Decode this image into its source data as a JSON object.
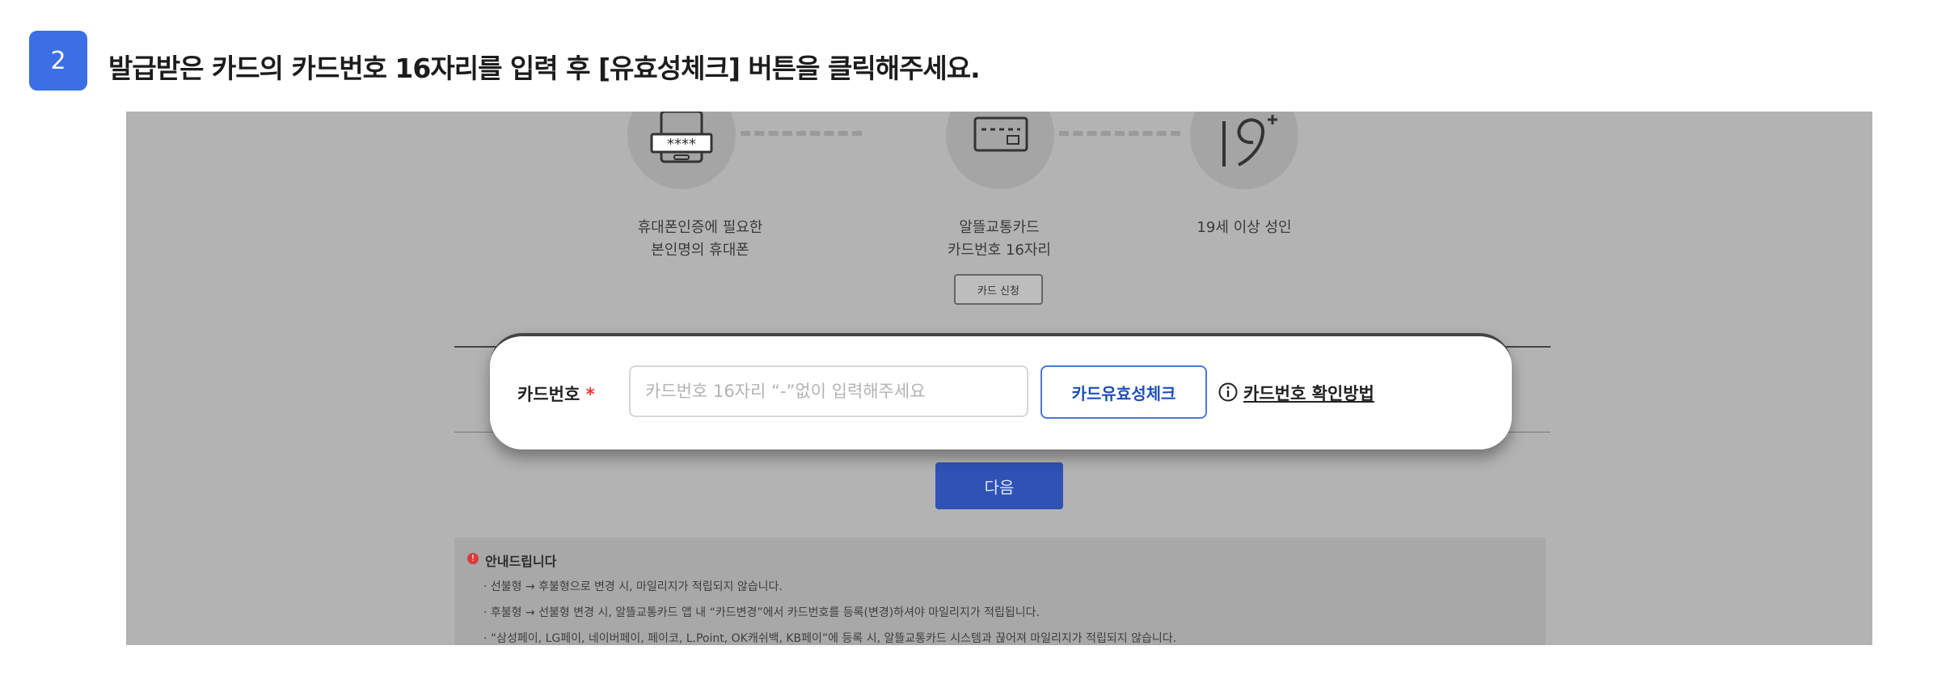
{
  "step": {
    "number": "2",
    "title": "발급받은 카드의 카드번호 16자리를 입력 후 [유효성체크] 버튼을 클릭해주세요."
  },
  "requirements": [
    {
      "icon": "phone-icon",
      "line1": "휴대폰인증에 필요한",
      "line2": "본인명의 휴대폰"
    },
    {
      "icon": "card-icon",
      "line1": "알뜰교통카드",
      "line2": "카드번호 16자리"
    },
    {
      "icon": "age-19-icon",
      "line1": "19세 이상 성인",
      "line2": ""
    }
  ],
  "apply_button": "카드 신청",
  "card_form": {
    "label": "카드번호",
    "required_mark": "*",
    "input_placeholder": "카드번호 16자리 “-”없이 입력해주세요",
    "input_value": "",
    "check_button": "카드유효성체크",
    "help_link": "카드번호 확인방법"
  },
  "next_button": "다음",
  "notice": {
    "title": "안내드립니다",
    "icon": "alert-icon",
    "lines": [
      "· 선불형 → 후불형으로 변경 시, 마일리지가 적립되지 않습니다.",
      "· 후불형 → 선불형 변경 시, 알뜰교통카드 앱 내 “카드변경”에서 카드번호를 등록(변경)하셔야 마일리지가 적립됩니다.",
      "· “삼성페이, LG페이, 네이버페이, 페이코, L.Point, OK캐쉬백, KB페이”에 등록 시, 알뜰교통카드 시스템과 끊어져 마일리지가 적립되지 않습니다."
    ]
  },
  "colors": {
    "accent": "#3b6fe3",
    "primary_button": "#2f52b5",
    "required": "#e33333",
    "overlay": "#b3b3b3"
  }
}
